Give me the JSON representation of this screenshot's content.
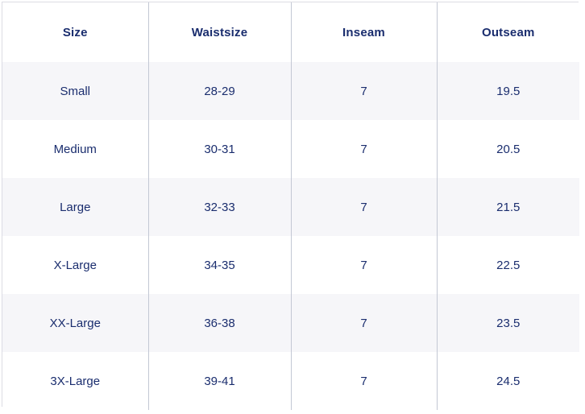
{
  "table": {
    "columns": [
      "Size",
      "Waistsize",
      "Inseam",
      "Outseam"
    ],
    "rows": [
      {
        "size": "Small",
        "waistsize": "28-29",
        "inseam": "7",
        "outseam": "19.5"
      },
      {
        "size": "Medium",
        "waistsize": "30-31",
        "inseam": "7",
        "outseam": "20.5"
      },
      {
        "size": "Large",
        "waistsize": "32-33",
        "inseam": "7",
        "outseam": "21.5"
      },
      {
        "size": "X-Large",
        "waistsize": "34-35",
        "inseam": "7",
        "outseam": "22.5"
      },
      {
        "size": "XX-Large",
        "waistsize": "36-38",
        "inseam": "7",
        "outseam": "23.5"
      },
      {
        "size": "3X-Large",
        "waistsize": "39-41",
        "inseam": "7",
        "outseam": "24.5"
      }
    ]
  },
  "colors": {
    "text": "#1a2d6e",
    "row_stripe": "#f6f6f9",
    "row_plain": "#ffffff",
    "cell_divider": "#c3c8d4",
    "outer_border": "#dcdce4"
  }
}
